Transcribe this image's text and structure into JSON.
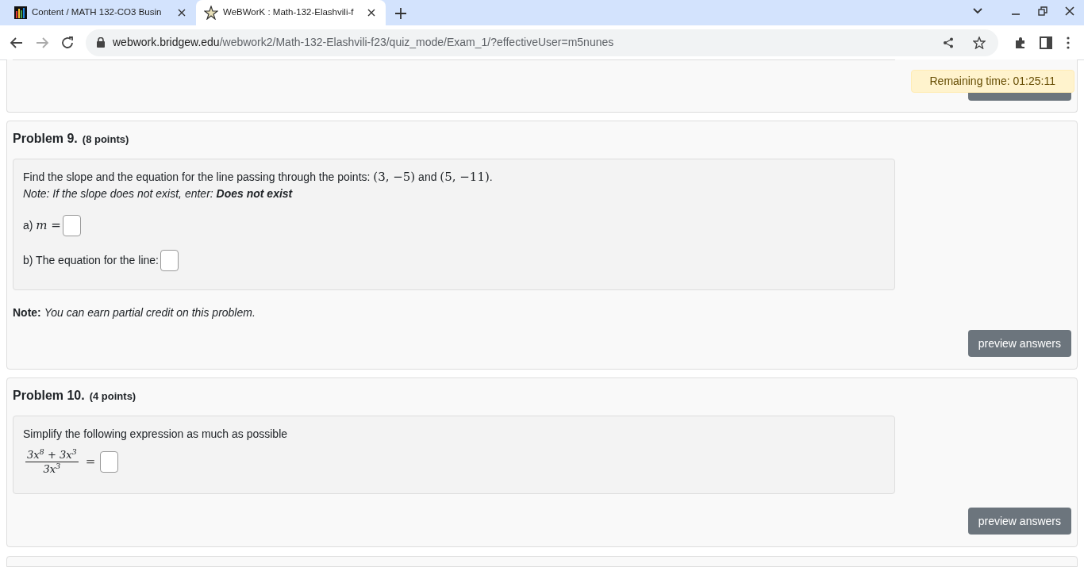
{
  "browser": {
    "tabs": [
      {
        "title": "Content / MATH 132-CO3 Busin",
        "selected": false
      },
      {
        "title": "WeBWorK : Math-132-Elashvili-f",
        "selected": true
      }
    ],
    "url": {
      "host": "webwork.bridgew.edu",
      "path": "/webwork2/Math-132-Elashvili-f23/quiz_mode/Exam_1/?effectiveUser=m5nunes"
    }
  },
  "timer": "Remaining time: 01:25:11",
  "problems": [
    {
      "title": "Problem 9.",
      "points": "(8 points)",
      "body": [
        {
          "kind": "line",
          "segments": [
            {
              "kind": "text",
              "text": "Find the slope and the equation for the line passing through the points: "
            },
            {
              "kind": "math",
              "text": "(3, −5)"
            },
            {
              "kind": "text",
              "text": " and "
            },
            {
              "kind": "math",
              "text": "(5, −11)"
            },
            {
              "kind": "text",
              "text": "."
            }
          ]
        },
        {
          "kind": "note",
          "text": "Note: If the slope does not exist, enter: **Does not exist**"
        },
        {
          "kind": "answer",
          "segments": [
            {
              "kind": "text",
              "text": "a) "
            },
            {
              "kind": "math",
              "text": "m ="
            }
          ]
        },
        {
          "kind": "answer",
          "segments": [
            {
              "kind": "text",
              "text": "b) The equation for the line:"
            }
          ]
        }
      ],
      "footnote": "**Note:** *You can earn partial credit on this problem.*",
      "button": "preview answers"
    },
    {
      "title": "Problem 10.",
      "points": "(4 points)",
      "body": [
        {
          "kind": "line",
          "segments": [
            {
              "kind": "text",
              "text": "Simplify the following expression as much as possible"
            }
          ]
        },
        {
          "kind": "fraction",
          "numerator": "3x$^{8}$ + 3x$^{3}$",
          "denominator": "3x$^{3}$",
          "after": "="
        }
      ],
      "button": "preview answers"
    }
  ]
}
